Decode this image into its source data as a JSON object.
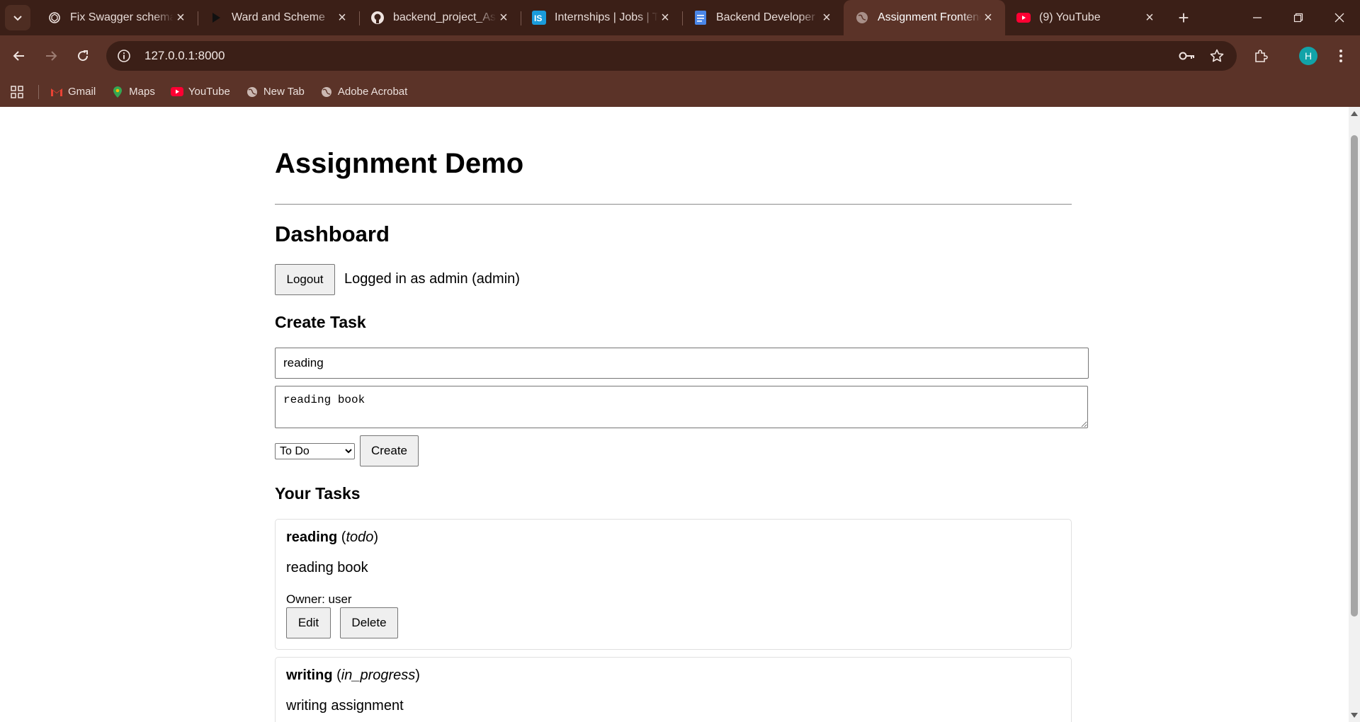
{
  "browser": {
    "tabs": [
      {
        "title": "Fix Swagger schema e",
        "icon": "openai-icon",
        "active": false
      },
      {
        "title": "Ward and Scheme",
        "icon": "play-icon",
        "active": false
      },
      {
        "title": "backend_project_Assi",
        "icon": "github-icon",
        "active": false
      },
      {
        "title": "Internships | Jobs | Tr",
        "icon": "internshala-icon",
        "active": false
      },
      {
        "title": "Backend Developer (",
        "icon": "docs-icon",
        "active": false
      },
      {
        "title": "Assignment Frontend",
        "icon": "globe-icon",
        "active": true
      },
      {
        "title": "(9) YouTube",
        "icon": "youtube-icon",
        "active": false
      }
    ],
    "url": "127.0.0.1:8000",
    "profile_initial": "H",
    "bookmarks": [
      {
        "label": "Gmail",
        "icon": "gmail-icon"
      },
      {
        "label": "Maps",
        "icon": "maps-icon"
      },
      {
        "label": "YouTube",
        "icon": "youtube-icon"
      },
      {
        "label": "New Tab",
        "icon": "globe-icon"
      },
      {
        "label": "Adobe Acrobat",
        "icon": "globe-icon"
      }
    ],
    "colors": {
      "frame": "#3b1f17",
      "toolbar": "#5b3328",
      "avatar": "#12a3a8"
    }
  },
  "page": {
    "title": "Assignment Demo",
    "dashboard": {
      "heading": "Dashboard",
      "logout_label": "Logout",
      "status": "Logged in as admin (admin)"
    },
    "create_task": {
      "heading": "Create Task",
      "title_value": "reading",
      "description_value": "reading book",
      "status_selected": "To Do",
      "create_label": "Create"
    },
    "tasks_heading": "Your Tasks",
    "tasks": [
      {
        "name": "reading",
        "status": "todo",
        "description": "reading book",
        "owner": "Owner: user",
        "edit_label": "Edit",
        "delete_label": "Delete"
      },
      {
        "name": "writing",
        "status": "in_progress",
        "description": "writing assignment"
      }
    ]
  }
}
